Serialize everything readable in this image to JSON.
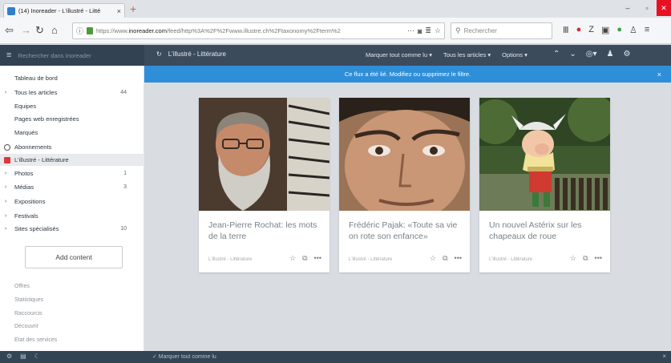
{
  "browser": {
    "tab_title": "(14) Inoreader - L'illustré - Litté",
    "tab_close": "×",
    "new_tab": "+",
    "win_min": "–",
    "win_max": "▫",
    "win_close": "✕",
    "url_prefix": "https://www.",
    "url_domain": "inoreader.com",
    "url_rest": "/feed/http%3A%2F%2Fwww.illustre.ch%2Ftaxonomy%2Fterm%2",
    "search_placeholder": "Rechercher"
  },
  "app": {
    "sidebar_search_placeholder": "Rechercher dans Inoreader",
    "feed_title": "L'illustré - Littérature",
    "actions": [
      "Marquer tout comme lu ▾",
      "Tous les articles ▾",
      "Options ▾"
    ],
    "notice": "Ce flux a été lié. Modifiez ou supprimez le filtre.",
    "notice_close": "×"
  },
  "sidebar": {
    "items": [
      {
        "label": "Tableau de bord",
        "count": "",
        "chevron": false
      },
      {
        "label": "Tous les articles",
        "count": "44",
        "chevron": true
      },
      {
        "label": "Equipes",
        "count": "",
        "chevron": false
      },
      {
        "label": "Pages web enregistrées",
        "count": "",
        "chevron": false
      },
      {
        "label": "Marqués",
        "count": "",
        "chevron": false
      },
      {
        "label": "Abonnements",
        "count": "",
        "chevron": false
      },
      {
        "label": "L'illustré - Littérature",
        "count": "",
        "chevron": false
      },
      {
        "label": "Photos",
        "count": "1",
        "chevron": true
      },
      {
        "label": "Médias",
        "count": "3",
        "chevron": true
      },
      {
        "label": "Expositions",
        "count": "",
        "chevron": true
      },
      {
        "label": "Festivals",
        "count": "",
        "chevron": true
      },
      {
        "label": "Sites spécialisés",
        "count": "10",
        "chevron": true
      }
    ],
    "add_content": "Add content",
    "footer_links": [
      "Offres",
      "Statistiques",
      "Raccourcis",
      "Découvrir",
      "Etat des services"
    ]
  },
  "bottom": {
    "mark_all": "✓ Marquer tout comme lu"
  },
  "cards": [
    {
      "headline": "Jean-Pierre Rochat: les mots de la terre",
      "source": "L'illustré - Littérature"
    },
    {
      "headline": "Frédéric Pajak: «Toute sa vie on rote son enfance»",
      "source": "L'illustré - Littérature"
    },
    {
      "headline": "Un nouvel Astérix sur les chapeaux de roue",
      "source": "L'illustré - Littérature"
    }
  ]
}
